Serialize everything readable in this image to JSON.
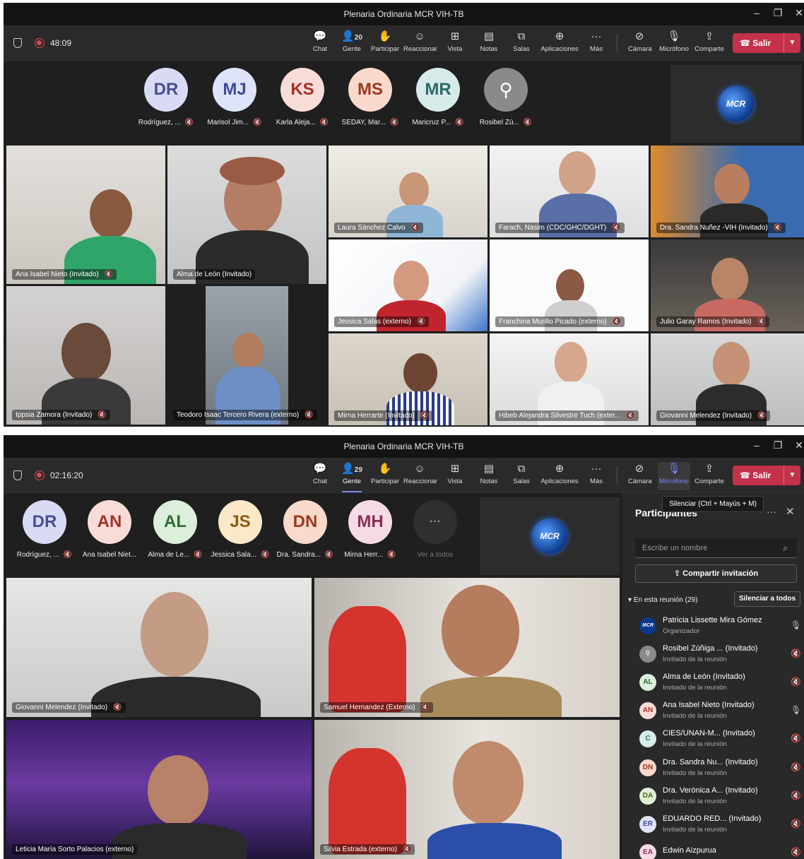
{
  "top": {
    "window_title": "Plenaria Ordinaria MCR VIH-TB",
    "timer": "48:09",
    "people_count": "20",
    "toolbar": {
      "chat": "Chat",
      "people": "Gente",
      "raise": "Participar",
      "react": "Reaccionar",
      "view": "Vista",
      "notes": "Notas",
      "rooms": "Salas",
      "apps": "Aplicaciones",
      "more": "Más",
      "camera": "Cámara",
      "mic": "Micrófono",
      "share": "Comparte",
      "leave": "Salir"
    },
    "avatars": [
      {
        "initials": "DR",
        "name": "Rodríguez, ...",
        "bg": "#d9dbf5",
        "fg": "#4b4e8f"
      },
      {
        "initials": "MJ",
        "name": "Marisol Jim...",
        "bg": "#dfe3fa",
        "fg": "#3e4a9a"
      },
      {
        "initials": "KS",
        "name": "Karla Aleja...",
        "bg": "#f8dcd8",
        "fg": "#a3312a"
      },
      {
        "initials": "MS",
        "name": "SEDAY, Mar...",
        "bg": "#f9d9cc",
        "fg": "#9a3a1c"
      },
      {
        "initials": "MR",
        "name": "Maricruz P...",
        "bg": "#d6ebea",
        "fg": "#2e6a67"
      },
      {
        "initials": "",
        "name": "Rosibel Zú...",
        "bg": "#8a8a8a",
        "fg": "#ffffff"
      }
    ],
    "mcr_logo": "MCR",
    "tiles": [
      {
        "name": "Ana Isabel Nieto (Invitado)"
      },
      {
        "name": "Alma de León (Invitado)"
      },
      {
        "name": "Laura Sánchez Calvo"
      },
      {
        "name": "Farach, Nasim (CDC/GHC/DGHT)"
      },
      {
        "name": "Dra. Sandra Nuñez -VIH (Invitado)"
      },
      {
        "name": "Jessica Salas (externo)"
      },
      {
        "name": "Franchina Murillo Picado (externo)"
      },
      {
        "name": "Julio Garay Ramos (Invitado)"
      },
      {
        "name": "Ippsia Zamora (Invitado)"
      },
      {
        "name": "Teodoro Isaac Tercero Rivera (externo)"
      },
      {
        "name": "Mirna Herrarte (Invitado)"
      },
      {
        "name": "Hibeb Alejandra Silvestre Tuch (exter..."
      },
      {
        "name": "Giovanni Melendez (Invitado)"
      }
    ]
  },
  "bottom": {
    "window_title": "Plenaria Ordinaria MCR VIH-TB",
    "timer": "02:16:20",
    "people_count": "29",
    "toolbar": {
      "chat": "Chat",
      "people": "Gente",
      "raise": "Participar",
      "react": "Reaccionar",
      "view": "Vista",
      "notes": "Notas",
      "rooms": "Salas",
      "apps": "Aplicaciones",
      "more": "Más",
      "camera": "Cámara",
      "mic": "Micrófono",
      "share": "Comparte",
      "leave": "Salir"
    },
    "avatars": [
      {
        "initials": "DR",
        "name": "Rodríguez, ...",
        "bg": "#d9dbf5",
        "fg": "#4b4e8f"
      },
      {
        "initials": "AN",
        "name": "Ana Isabel Niet...",
        "bg": "#f8dcd8",
        "fg": "#a3312a"
      },
      {
        "initials": "AL",
        "name": "Alma de Le...",
        "bg": "#dcefdc",
        "fg": "#2f6b2f"
      },
      {
        "initials": "JS",
        "name": "Jessica Sala...",
        "bg": "#fbe8c8",
        "fg": "#8a5a10"
      },
      {
        "initials": "DN",
        "name": "Dra. Sandra...",
        "bg": "#f9d9cc",
        "fg": "#9a3a1c"
      },
      {
        "initials": "MH",
        "name": "Mirna Herr...",
        "bg": "#f5dbe6",
        "fg": "#8a2f55"
      }
    ],
    "more_label": "Ver a todos",
    "more_icon": "···",
    "mcr_logo": "MCR",
    "tiles": [
      {
        "name": "Giovanni Melendez (Invitado)"
      },
      {
        "name": "Samuel Hernandez (Externo)"
      },
      {
        "name": "Leticia María Sorto Palacios (externo)"
      },
      {
        "name": "Silvia Estrada (externo)"
      }
    ],
    "panel": {
      "title": "Participantes",
      "tooltip": "Silenciar (Ctrl + Mayús + M)",
      "search_placeholder": "Escribe un nombre",
      "invite": "Compartir invitación",
      "section": "En esta reunión (29)",
      "mute_all": "Silenciar a todos",
      "participants": [
        {
          "initials": "MCR",
          "name": "Patricia Lissette Mira Gómez",
          "role": "Organizador",
          "bg": "#0b3a8c",
          "fg": "#ffffff",
          "mic": "on"
        },
        {
          "initials": "",
          "name": "Rosibel Zúñiga ... (Invitado)",
          "role": "Invitado de la reunión",
          "bg": "#8a8a8a",
          "fg": "#ffffff",
          "mic": "muted"
        },
        {
          "initials": "AL",
          "name": "Alma de León (Invitado)",
          "role": "Invitado de la reunión",
          "bg": "#dcefdc",
          "fg": "#2f6b2f",
          "mic": "muted"
        },
        {
          "initials": "AN",
          "name": "Ana Isabel Nieto (Invitado)",
          "role": "Invitado de la reunión",
          "bg": "#f8dcd8",
          "fg": "#a3312a",
          "mic": "on"
        },
        {
          "initials": "C",
          "name": "CIES/UNAN-M... (Invitado)",
          "role": "Invitado de la reunión",
          "bg": "#d6ebea",
          "fg": "#2e6a67",
          "mic": "muted"
        },
        {
          "initials": "DN",
          "name": "Dra. Sandra Nu... (Invitado)",
          "role": "Invitado de la reunión",
          "bg": "#f9d9cc",
          "fg": "#9a3a1c",
          "mic": "muted"
        },
        {
          "initials": "DA",
          "name": "Dra. Verónica A... (Invitado)",
          "role": "Invitado de la reunión",
          "bg": "#e3eed6",
          "fg": "#4a6a26",
          "mic": "muted"
        },
        {
          "initials": "ER",
          "name": "EDUARDO RED... (Invitado)",
          "role": "Invitado de la reunión",
          "bg": "#dfe3fa",
          "fg": "#3e4a9a",
          "mic": "muted"
        },
        {
          "initials": "EA",
          "name": "Edwin Aizpurua",
          "role": "",
          "bg": "#f5dbe6",
          "fg": "#8a2f55",
          "mic": "muted"
        }
      ]
    }
  }
}
